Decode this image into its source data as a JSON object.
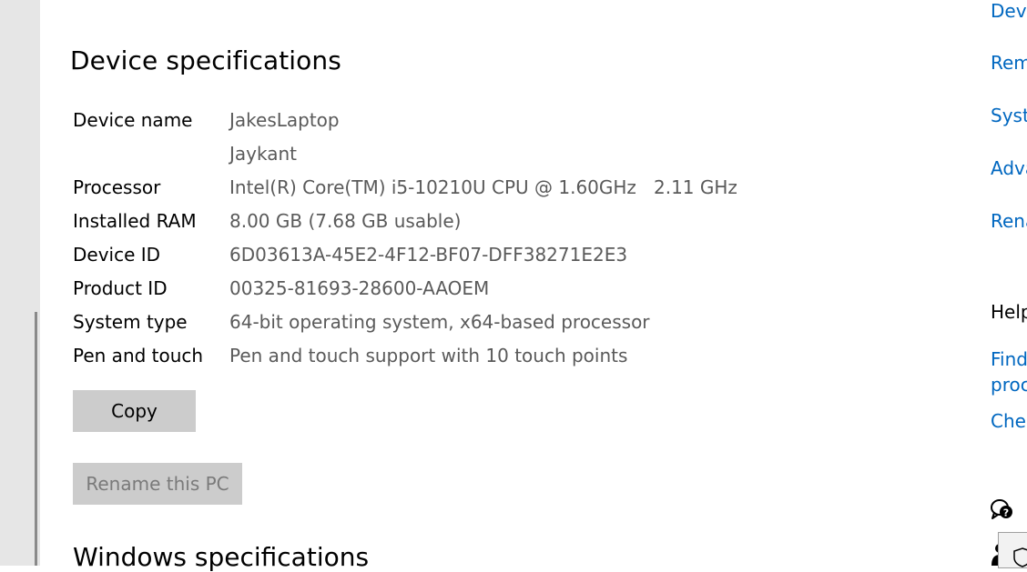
{
  "device_specs": {
    "title": "Device specifications",
    "rows": [
      {
        "label": "Device name",
        "value": "JakesLaptop"
      },
      {
        "label": "",
        "value": "Jaykant"
      },
      {
        "label": "Processor",
        "value": "Intel(R) Core(TM) i5-10210U CPU @ 1.60GHz   2.11 GHz"
      },
      {
        "label": "Installed RAM",
        "value": "8.00 GB (7.68 GB usable)"
      },
      {
        "label": "Device ID",
        "value": "6D03613A-45E2-4F12-BF07-DFF38271E2E3"
      },
      {
        "label": "Product ID",
        "value": "00325-81693-28600-AAOEM"
      },
      {
        "label": "System type",
        "value": "64-bit operating system, x64-based processor"
      },
      {
        "label": "Pen and touch",
        "value": "Pen and touch support with 10 touch points"
      }
    ],
    "copy_label": "Copy",
    "rename_label": "Rename this PC"
  },
  "windows_specs": {
    "title": "Windows specifications"
  },
  "related": {
    "links": [
      "Devi",
      "Rem",
      "Syste",
      "Adva",
      "Rena"
    ],
    "help_heading": "Help",
    "help_links": [
      "Find",
      "proc",
      "Chec"
    ]
  },
  "icons": {
    "help": "get-help-icon",
    "feedback": "person-feedback-icon",
    "security": "shield-icon"
  },
  "colors": {
    "link": "#0067c0",
    "value_text": "#5a5a5a",
    "button_bg": "#cccccc",
    "rail_bg": "#e6e6e6"
  }
}
